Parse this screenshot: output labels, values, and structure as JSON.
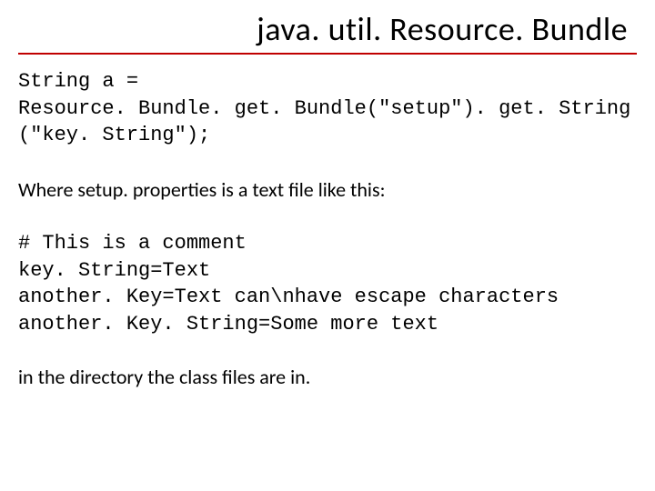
{
  "title": "java. util. Resource. Bundle",
  "code_line1": "String a =",
  "code_line2": "Resource. Bundle. get. Bundle(\"setup\"). get. String",
  "code_line3": "(\"key. String\");",
  "description": "Where setup. properties is a text file like this:",
  "prop_line1": "# This is a comment",
  "prop_line2": "key. String=Text",
  "prop_line3": "another. Key=Text can\\nhave escape characters",
  "prop_line4": "another. Key. String=Some more text",
  "footer": "in the directory the class files are in."
}
